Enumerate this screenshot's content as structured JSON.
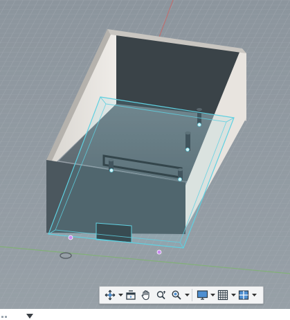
{
  "viewport": {
    "background_color": "#8f98a0",
    "grid_color": "#a3abb2",
    "x_axis_color": "#c66",
    "y_axis_color": "#7db36b",
    "model": {
      "name": "enclosure-box",
      "outer_color": "#465259",
      "inner_wall_color": "#ebe8e3",
      "selection_color": "#5fd0e0"
    }
  },
  "toolbar": {
    "items": [
      {
        "id": "orbit",
        "icon": "orbit-icon",
        "has_dropdown": true
      },
      {
        "id": "look-at",
        "icon": "look-at-icon",
        "has_dropdown": false
      },
      {
        "id": "pan",
        "icon": "pan-hand-icon",
        "has_dropdown": false
      },
      {
        "id": "zoom",
        "icon": "zoom-icon",
        "has_dropdown": false
      },
      {
        "id": "fit",
        "icon": "fit-magnifier-icon",
        "has_dropdown": true
      },
      {
        "id": "display-settings",
        "icon": "monitor-icon",
        "has_dropdown": true
      },
      {
        "id": "grid-settings",
        "icon": "grid-icon",
        "has_dropdown": true
      },
      {
        "id": "viewports",
        "icon": "viewports-icon",
        "has_dropdown": true
      }
    ]
  }
}
